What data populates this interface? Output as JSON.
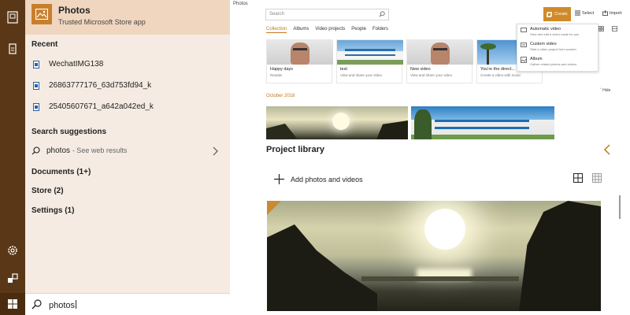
{
  "start_menu": {
    "best_match": {
      "title": "Photos",
      "subtitle": "Trusted Microsoft Store app"
    },
    "recent_heading": "Recent",
    "recent_items": [
      "WechatIMG138",
      "26863777176_63d753fd94_k",
      "25405607671_a642a042ed_k"
    ],
    "suggestions_heading": "Search suggestions",
    "suggestion": {
      "term": "photos",
      "hint": "- See web results"
    },
    "categories": [
      "Documents (1+)",
      "Store (2)",
      "Settings (1)"
    ],
    "search_query": "photos"
  },
  "photos_app": {
    "window_title": "Photos",
    "search_placeholder": "Search",
    "toolbar": {
      "create": "Create",
      "select": "Select",
      "import": "Import"
    },
    "create_menu": [
      {
        "title": "Automatic video",
        "subtitle": "View and edit a video made for you"
      },
      {
        "title": "Custom video",
        "subtitle": "Start a video project from scratch"
      },
      {
        "title": "Album",
        "subtitle": "Gather related photos and videos"
      }
    ],
    "tabs": [
      "Collection",
      "Albums",
      "Video projects",
      "People",
      "Folders"
    ],
    "cards": [
      {
        "name": "Happy days",
        "sub": "Rewide"
      },
      {
        "name": "test",
        "sub": "View and share your video"
      },
      {
        "name": "New video",
        "sub": "View and share your video"
      },
      {
        "name": "You're the direct...",
        "sub": "Create a video with music"
      }
    ],
    "hide_label": "Hide",
    "section_date": "October 2018",
    "project_library": "Project library",
    "add_photos_label": "Add photos and videos"
  },
  "colors": {
    "accent": "#d08a29",
    "rail": "#5a3817",
    "panel": "#f5ebe2",
    "highlight": "#f0d6bf"
  }
}
